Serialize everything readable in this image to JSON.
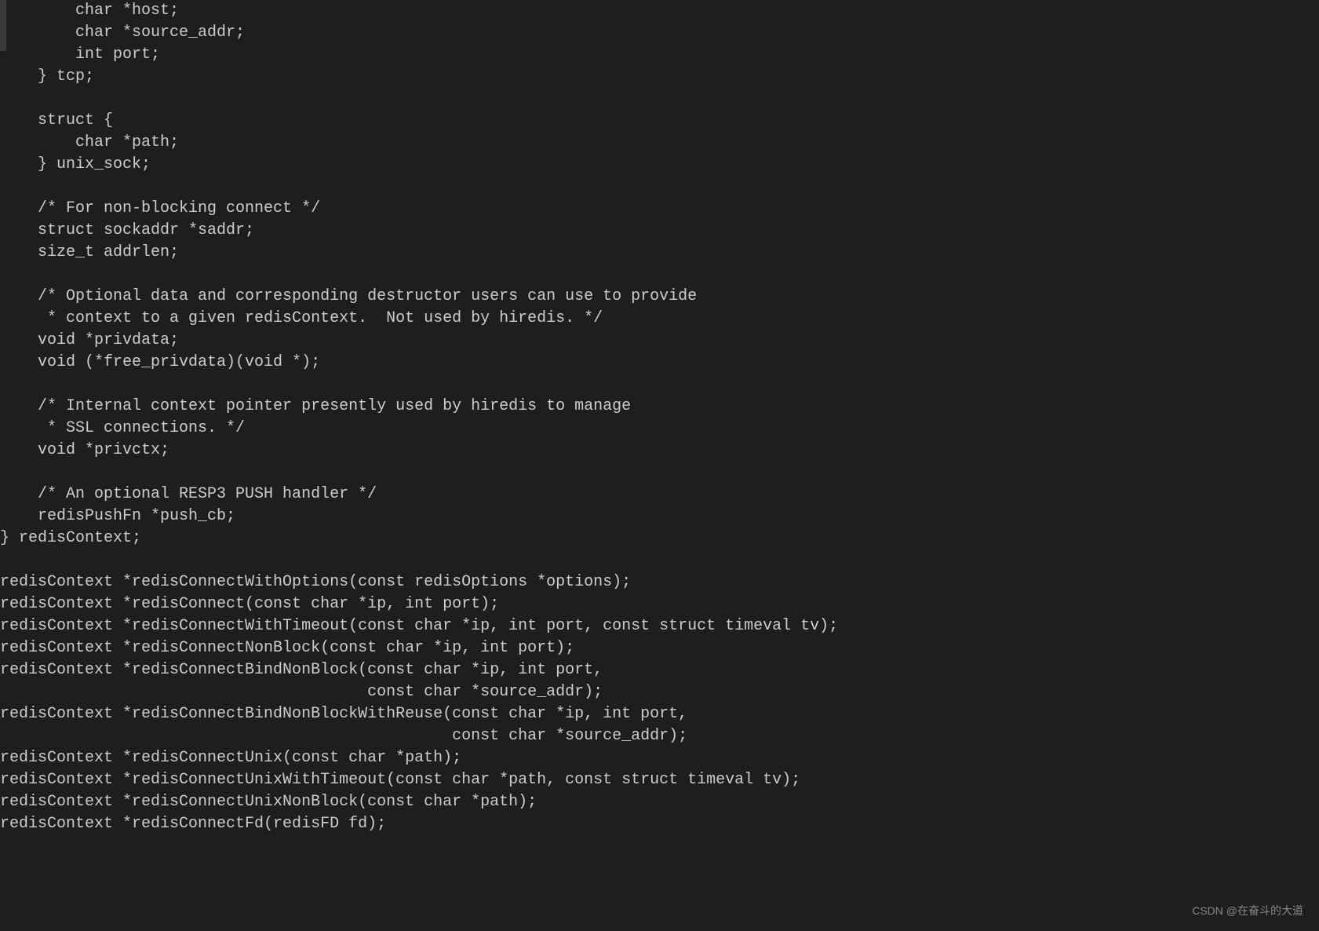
{
  "code_lines": [
    "        char *host;",
    "        char *source_addr;",
    "        int port;",
    "    } tcp;",
    "",
    "    struct {",
    "        char *path;",
    "    } unix_sock;",
    "",
    "    /* For non-blocking connect */",
    "    struct sockaddr *saddr;",
    "    size_t addrlen;",
    "",
    "    /* Optional data and corresponding destructor users can use to provide",
    "     * context to a given redisContext.  Not used by hiredis. */",
    "    void *privdata;",
    "    void (*free_privdata)(void *);",
    "",
    "    /* Internal context pointer presently used by hiredis to manage",
    "     * SSL connections. */",
    "    void *privctx;",
    "",
    "    /* An optional RESP3 PUSH handler */",
    "    redisPushFn *push_cb;",
    "} redisContext;",
    "",
    "redisContext *redisConnectWithOptions(const redisOptions *options);",
    "redisContext *redisConnect(const char *ip, int port);",
    "redisContext *redisConnectWithTimeout(const char *ip, int port, const struct timeval tv);",
    "redisContext *redisConnectNonBlock(const char *ip, int port);",
    "redisContext *redisConnectBindNonBlock(const char *ip, int port,",
    "                                       const char *source_addr);",
    "redisContext *redisConnectBindNonBlockWithReuse(const char *ip, int port,",
    "                                                const char *source_addr);",
    "redisContext *redisConnectUnix(const char *path);",
    "redisContext *redisConnectUnixWithTimeout(const char *path, const struct timeval tv);",
    "redisContext *redisConnectUnixNonBlock(const char *path);",
    "redisContext *redisConnectFd(redisFD fd);"
  ],
  "watermark": "CSDN @在奋斗的大道"
}
